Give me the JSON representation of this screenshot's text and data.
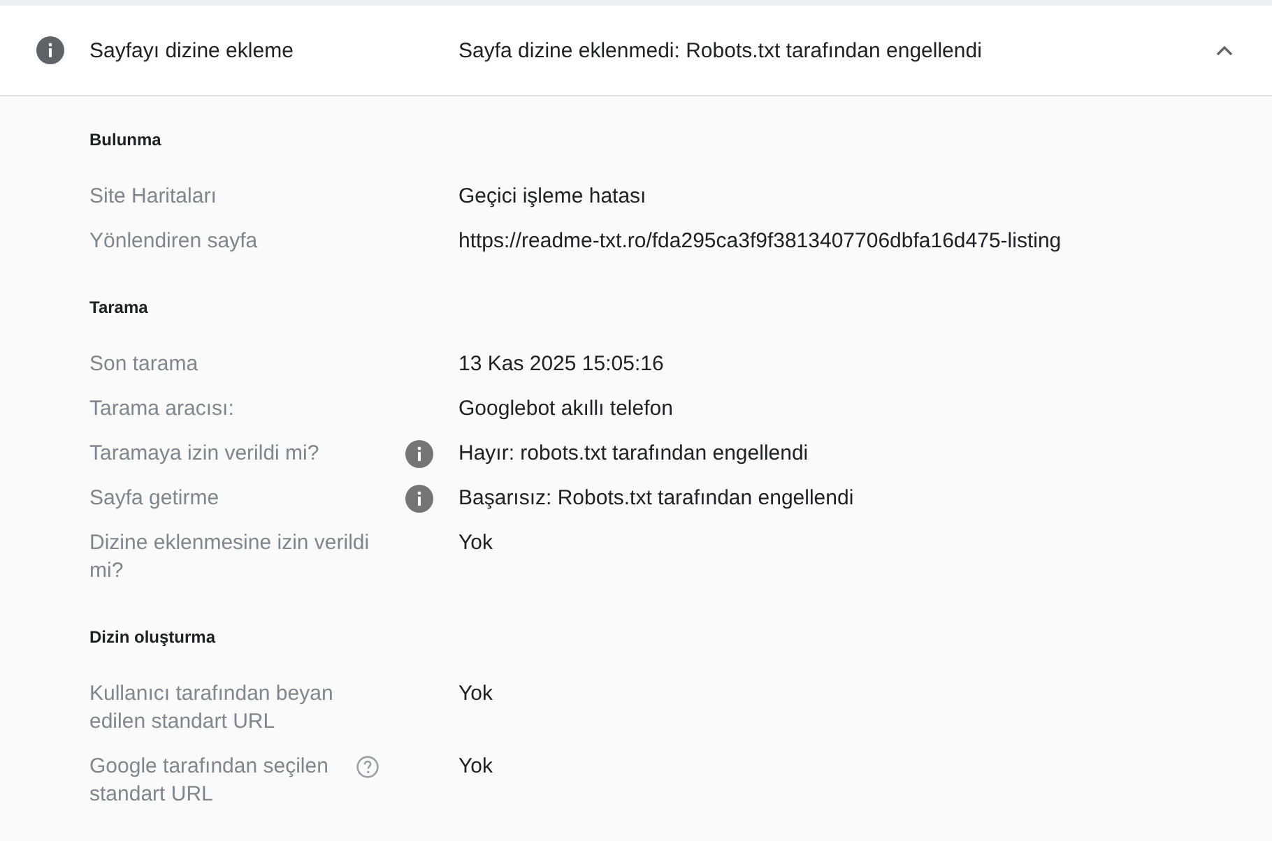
{
  "header": {
    "title": "Sayfayı dizine ekleme",
    "status": "Sayfa dizine eklenmedi: Robots.txt tarafından engellendi",
    "expanded": true
  },
  "sections": [
    {
      "heading": "Bulunma",
      "rows": [
        {
          "kind": "plain",
          "label": "Site Haritaları",
          "value": "Geçici işleme hatası"
        },
        {
          "kind": "plain",
          "label": "Yönlendiren sayfa",
          "value": "https://readme-txt.ro/fda295ca3f9f3813407706dbfa16d475-listing"
        }
      ]
    },
    {
      "heading": "Tarama",
      "rows": [
        {
          "kind": "plain",
          "label": "Son tarama",
          "value": "13 Kas 2025 15:05:16"
        },
        {
          "kind": "plain",
          "label": "Tarama aracısı:",
          "value": "Googlebot akıllı telefon"
        },
        {
          "kind": "info",
          "label": "Taramaya izin verildi mi?",
          "value": "Hayır: robots.txt tarafından engellendi"
        },
        {
          "kind": "info",
          "label": "Sayfa getirme",
          "value": "Başarısız: Robots.txt tarafından engellendi"
        },
        {
          "kind": "plain",
          "label": "Dizine eklenmesine izin verildi mi?",
          "value": "Yok"
        }
      ]
    },
    {
      "heading": "Dizin oluşturma",
      "rows": [
        {
          "kind": "plain",
          "label": "Kullanıcı tarafından beyan edilen standart URL",
          "value": "Yok"
        },
        {
          "kind": "help",
          "label": "Google tarafından seçilen standart URL",
          "value": "Yok"
        }
      ]
    }
  ]
}
